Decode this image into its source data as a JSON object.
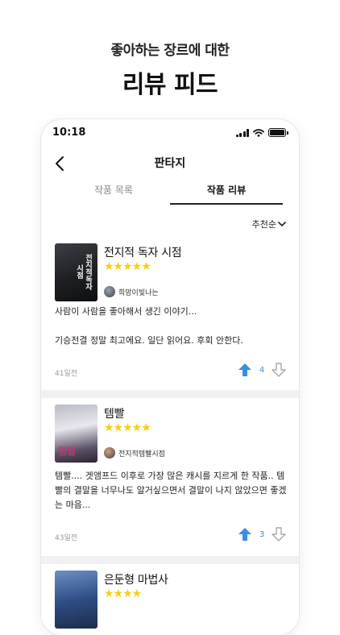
{
  "promo": {
    "subtitle": "좋아하는 장르에 대한",
    "title": "리뷰 피드"
  },
  "status_bar": {
    "time": "10:18"
  },
  "nav": {
    "title": "판타지"
  },
  "tabs": [
    {
      "label": "작품 목록",
      "active": false
    },
    {
      "label": "작품 리뷰",
      "active": true
    }
  ],
  "sort": {
    "label": "추천순"
  },
  "reviews": [
    {
      "title": "전지적 독자 시점",
      "cover_text": "전지적독자시점",
      "rating": 5,
      "stars": "★★★★★",
      "author": "희망이빛나는",
      "lines": [
        "사람이 사람을 좋아해서 생긴 이야기..."
      ],
      "body": "기승전결 정말 최고에요. 일단 읽어요. 후회 안한다.",
      "date": "41일전",
      "votes": "4"
    },
    {
      "title": "템빨",
      "cover_text": "템빨",
      "rating": 5,
      "stars": "★★★★★",
      "author": "전지적템빨시점",
      "body": "템빨.... 겟앰프드 이후로 가장 많은 캐시를 지르게 한 작품.. 템빨의 결말을 너무나도 알거싶으면서 결말이 나지 않았으면 좋겠는 마음...",
      "date": "43일전",
      "votes": "3"
    },
    {
      "title": "은둔형 마법사",
      "rating": 4,
      "stars": "★★★★"
    }
  ],
  "colors": {
    "accent": "#3a8fe0",
    "star": "#f6d012",
    "background": "#f1f1f3"
  },
  "icons": {
    "back": "chevron-left-icon",
    "sort": "chevron-down-icon",
    "upvote": "arrow-up-icon",
    "downvote": "arrow-down-icon"
  }
}
